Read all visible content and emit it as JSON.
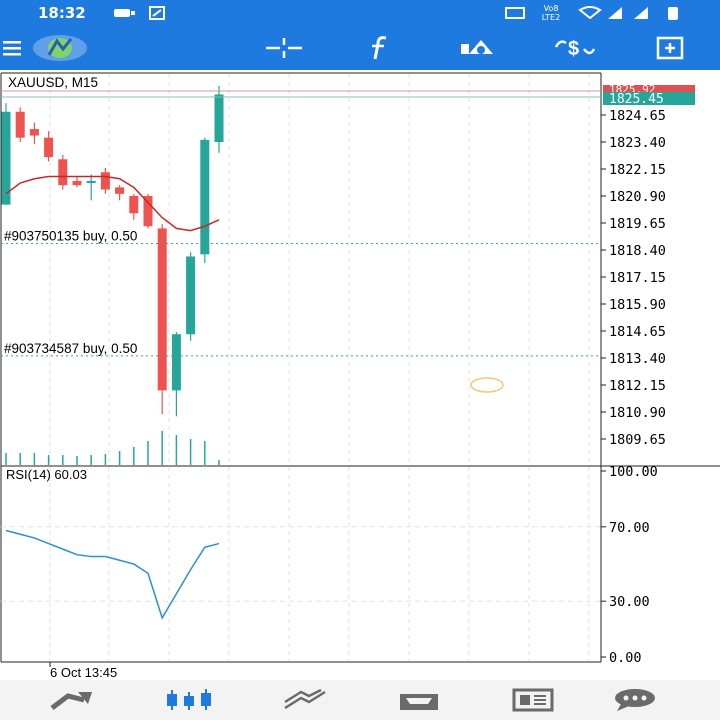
{
  "status_bar": {
    "time": "18:32",
    "indicator_text": "Vo8 LTE2",
    "battery": "battery-icon"
  },
  "app_bar": {
    "menu_icon": "hamburger-icon",
    "logo_icon": "metatrader-logo-icon",
    "actions": [
      {
        "name": "crosshair-icon"
      },
      {
        "name": "indicators-f-icon"
      },
      {
        "name": "objects-icon"
      },
      {
        "name": "symbol-dollar-icon"
      },
      {
        "name": "new-order-icon"
      }
    ]
  },
  "chart": {
    "symbol_label": "XAUUSD, M15",
    "current_price": "1825.45",
    "hidden_price": "1825.92",
    "price_ticks": [
      "1824.65",
      "1823.40",
      "1822.15",
      "1820.90",
      "1819.65",
      "1818.40",
      "1817.15",
      "1815.90",
      "1814.65",
      "1813.40",
      "1812.15",
      "1810.90",
      "1809.65"
    ],
    "orders": [
      {
        "label": "#903750135 buy, 0.50",
        "price": 1818.7
      },
      {
        "label": "#903734587 buy, 0.50",
        "price": 1813.5
      }
    ],
    "time_label": "6 Oct 13:45",
    "colors": {
      "bull": "#26a69a",
      "bear": "#ef5350",
      "ma": "#c62828",
      "rsi": "#2b8fd0",
      "grid": "#e1e1e1"
    }
  },
  "rsi": {
    "label": "RSI(14) 60.03",
    "levels": [
      "100.00",
      "70.00",
      "30.00",
      "0.00"
    ]
  },
  "chart_data": {
    "type": "candlestick",
    "ylim": [
      1809.2,
      1826.5
    ],
    "candles": [
      {
        "o": 1820.5,
        "h": 1825.2,
        "l": 1820.5,
        "c": 1824.8
      },
      {
        "o": 1824.8,
        "h": 1825.0,
        "l": 1823.4,
        "c": 1823.6
      },
      {
        "o": 1824.0,
        "h": 1824.3,
        "l": 1823.3,
        "c": 1823.7
      },
      {
        "o": 1823.6,
        "h": 1823.9,
        "l": 1822.5,
        "c": 1822.7
      },
      {
        "o": 1822.6,
        "h": 1822.8,
        "l": 1821.2,
        "c": 1821.4
      },
      {
        "o": 1821.6,
        "h": 1821.8,
        "l": 1821.3,
        "c": 1821.4
      },
      {
        "o": 1821.5,
        "h": 1821.9,
        "l": 1820.7,
        "c": 1821.6
      },
      {
        "o": 1822.0,
        "h": 1822.2,
        "l": 1821.0,
        "c": 1821.2
      },
      {
        "o": 1821.3,
        "h": 1821.4,
        "l": 1820.7,
        "c": 1821.0
      },
      {
        "o": 1820.9,
        "h": 1821.0,
        "l": 1819.8,
        "c": 1820.1
      },
      {
        "o": 1820.9,
        "h": 1821.0,
        "l": 1819.4,
        "c": 1819.5
      },
      {
        "o": 1819.4,
        "h": 1819.6,
        "l": 1810.8,
        "c": 1811.9
      },
      {
        "o": 1811.9,
        "h": 1814.6,
        "l": 1810.7,
        "c": 1814.5
      },
      {
        "o": 1814.5,
        "h": 1818.3,
        "l": 1814.2,
        "c": 1818.1
      },
      {
        "o": 1818.2,
        "h": 1823.6,
        "l": 1817.8,
        "c": 1823.5
      },
      {
        "o": 1823.4,
        "h": 1826.0,
        "l": 1822.9,
        "c": 1825.6
      }
    ],
    "ma": [
      1821.0,
      1821.5,
      1821.7,
      1821.8,
      1821.8,
      1821.8,
      1821.8,
      1821.8,
      1821.7,
      1821.3,
      1820.6,
      1819.9,
      1819.4,
      1819.3,
      1819.5,
      1819.8
    ],
    "volume": [
      12,
      12,
      12,
      10,
      10,
      9,
      10,
      11,
      14,
      18,
      24,
      34,
      30,
      26,
      24,
      5
    ],
    "rsi_values": [
      68,
      66,
      64,
      61,
      58,
      55,
      54,
      54,
      52,
      50,
      45,
      21,
      34,
      47,
      59,
      61
    ]
  }
}
